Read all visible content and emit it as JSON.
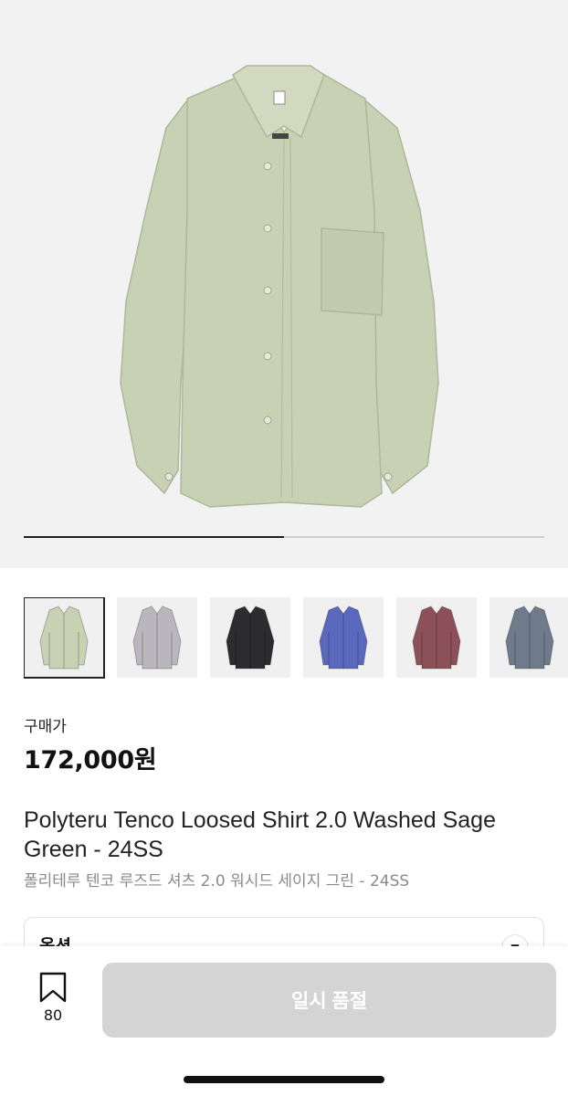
{
  "product": {
    "image_position": 0.5,
    "price_label": "구매가",
    "price": "172,000원",
    "title": "Polyteru Tenco Loosed Shirt 2.0 Washed Sage Green - 24SS",
    "subtitle": "폴리테루 텐코 루즈드 셔츠 2.0 워시드 세이지 그린 - 24SS"
  },
  "thumbnails": [
    {
      "name": "sage",
      "color": "#c9d1b4",
      "selected": true
    },
    {
      "name": "grey",
      "color": "#b9b7bd",
      "selected": false
    },
    {
      "name": "black",
      "color": "#2c2c2e",
      "selected": false
    },
    {
      "name": "blue",
      "color": "#5a68bd",
      "selected": false
    },
    {
      "name": "burgundy",
      "color": "#8c5058",
      "selected": false
    },
    {
      "name": "slate",
      "color": "#6f7a8a",
      "selected": false
    }
  ],
  "options": {
    "label": "옵션"
  },
  "bottom_bar": {
    "bookmark_icon": "bookmark-icon",
    "bookmark_count": "80",
    "button_label": "일시 품절"
  },
  "colors": {
    "hero_bg": "#f2f2f2",
    "shirt": "#c9d1b4",
    "button_disabled": "#d4d4d4"
  }
}
